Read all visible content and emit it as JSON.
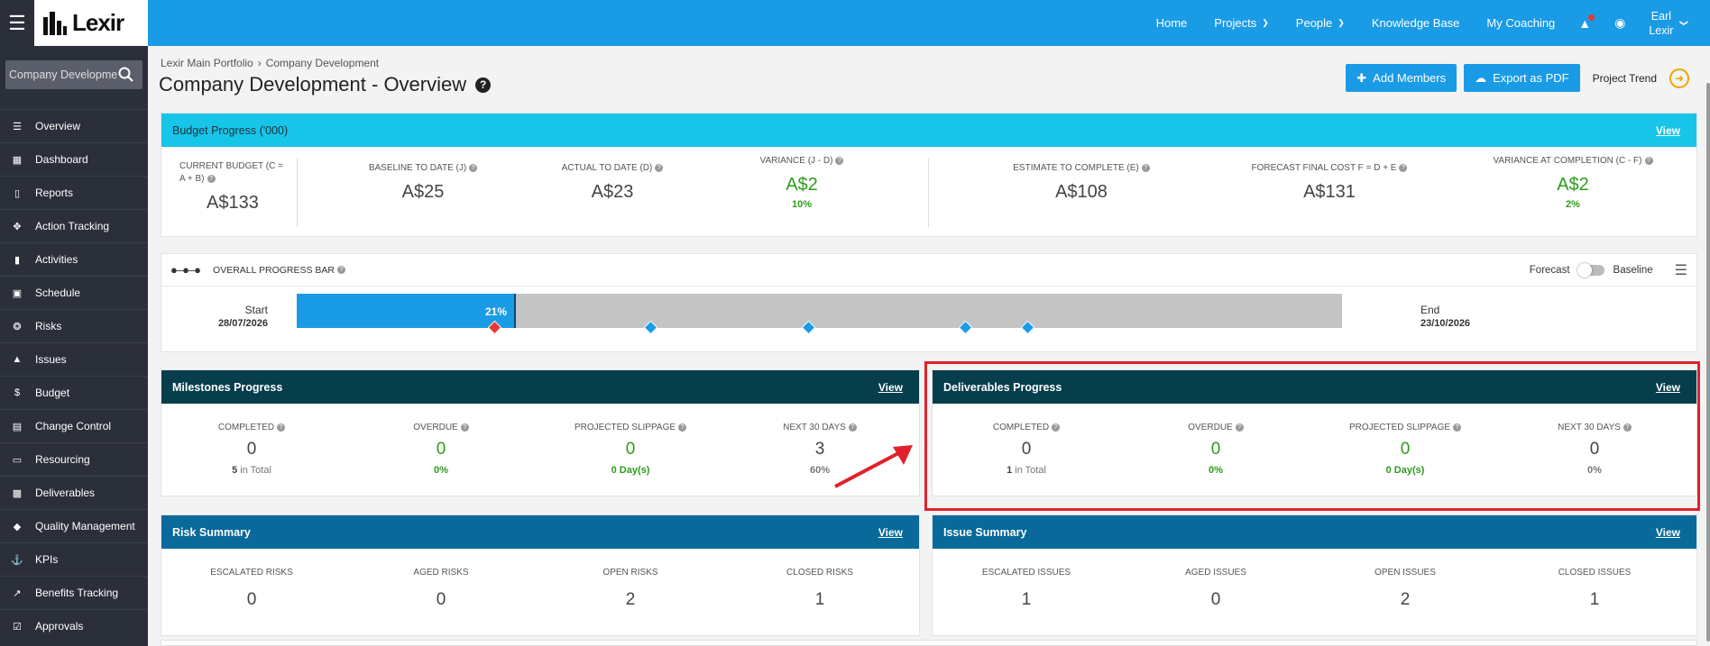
{
  "brand": {
    "logo_text": "Lexir"
  },
  "topnav": {
    "items": [
      {
        "label": "Home",
        "dropdown": false
      },
      {
        "label": "Projects",
        "dropdown": true
      },
      {
        "label": "People",
        "dropdown": true
      },
      {
        "label": "Knowledge Base",
        "dropdown": false
      },
      {
        "label": "My Coaching",
        "dropdown": false
      }
    ],
    "user": {
      "first": "Earl",
      "last": "Lexir"
    }
  },
  "sidebar": {
    "search_value": "Company Development",
    "items": [
      {
        "label": "Overview",
        "icon": "list-icon"
      },
      {
        "label": "Dashboard",
        "icon": "dashboard-icon"
      },
      {
        "label": "Reports",
        "icon": "bar-chart-icon"
      },
      {
        "label": "Action Tracking",
        "icon": "move-icon"
      },
      {
        "label": "Activities",
        "icon": "bookmark-icon"
      },
      {
        "label": "Schedule",
        "icon": "calendar-icon"
      },
      {
        "label": "Risks",
        "icon": "bulb-icon"
      },
      {
        "label": "Issues",
        "icon": "warning-icon"
      },
      {
        "label": "Budget",
        "icon": "dollar-icon"
      },
      {
        "label": "Change Control",
        "icon": "server-icon"
      },
      {
        "label": "Resourcing",
        "icon": "folder-icon"
      },
      {
        "label": "Deliverables",
        "icon": "truck-icon"
      },
      {
        "label": "Quality Management",
        "icon": "tag-icon"
      },
      {
        "label": "KPIs",
        "icon": "anchor-icon"
      },
      {
        "label": "Benefits Tracking",
        "icon": "trend-icon"
      },
      {
        "label": "Approvals",
        "icon": "check-square-icon"
      }
    ]
  },
  "header": {
    "breadcrumb": [
      "Lexir Main Portfolio",
      "Company Development"
    ],
    "title": "Company Development - Overview",
    "add_members": "Add Members",
    "export_pdf": "Export as PDF",
    "project_trend": "Project Trend"
  },
  "budget": {
    "title": "Budget Progress ('000)",
    "view": "View",
    "cells": [
      {
        "label": "CURRENT BUDGET (C = A + B)",
        "value": "A$133",
        "sub": ""
      },
      {
        "label": "BASELINE TO DATE (J)",
        "value": "A$25",
        "sub": ""
      },
      {
        "label": "ACTUAL TO DATE (D)",
        "value": "A$23",
        "sub": ""
      },
      {
        "label": "VARIANCE (J - D)",
        "value": "A$2",
        "sub": "10%"
      },
      {
        "label": "ESTIMATE TO COMPLETE (E)",
        "value": "A$108",
        "sub": ""
      },
      {
        "label": "FORECAST FINAL COST F = D + E",
        "value": "A$131",
        "sub": ""
      },
      {
        "label": "VARIANCE AT COMPLETION (C - F)",
        "value": "A$2",
        "sub": "2%"
      }
    ]
  },
  "overall": {
    "title": "OVERALL PROGRESS BAR",
    "forecast": "Forecast",
    "baseline": "Baseline",
    "start_label": "Start",
    "start_date": "28/07/2026",
    "end_label": "End",
    "end_date": "23/10/2026",
    "percent_label": "21%",
    "progress_fraction": 0.21,
    "milestone_fractions": [
      0.19,
      0.339,
      0.49,
      0.64,
      0.7
    ],
    "milestone_overdue": [
      true,
      false,
      false,
      false,
      false
    ]
  },
  "milestones": {
    "title": "Milestones Progress",
    "view": "View",
    "completed_label": "COMPLETED",
    "completed": "0",
    "total_num": "5",
    "total_word": "in Total",
    "overdue_label": "OVERDUE",
    "overdue": "0",
    "overdue_pct": "0%",
    "slippage_label": "PROJECTED SLIPPAGE",
    "slippage": "0",
    "slippage_days": "0 Day(s)",
    "next30_label": "NEXT 30 DAYS",
    "next30": "3",
    "next30_pct": "60%"
  },
  "deliverables": {
    "title": "Deliverables Progress",
    "view": "View",
    "completed_label": "COMPLETED",
    "completed": "0",
    "total_num": "1",
    "total_word": "in Total",
    "overdue_label": "OVERDUE",
    "overdue": "0",
    "overdue_pct": "0%",
    "slippage_label": "PROJECTED SLIPPAGE",
    "slippage": "0",
    "slippage_days": "0 Day(s)",
    "next30_label": "NEXT 30 DAYS",
    "next30": "0",
    "next30_pct": "0%"
  },
  "risk": {
    "title": "Risk Summary",
    "view": "View",
    "cells": [
      {
        "label": "ESCALATED RISKS",
        "value": "0"
      },
      {
        "label": "AGED RISKS",
        "value": "0"
      },
      {
        "label": "OPEN RISKS",
        "value": "2"
      },
      {
        "label": "CLOSED RISKS",
        "value": "1"
      }
    ]
  },
  "issue": {
    "title": "Issue Summary",
    "view": "View",
    "cells": [
      {
        "label": "ESCALATED ISSUES",
        "value": "1"
      },
      {
        "label": "AGED ISSUES",
        "value": "0"
      },
      {
        "label": "OPEN ISSUES",
        "value": "2"
      },
      {
        "label": "CLOSED ISSUES",
        "value": "1"
      }
    ]
  },
  "colors": {
    "topbar": "#1a9be6",
    "sidebar": "#2b2f3a",
    "budget_header": "#17c5e8",
    "panel_dark": "#063e4b",
    "panel_blue": "#08699a",
    "positive": "#2e9c1a",
    "highlight": "#e0212b"
  }
}
